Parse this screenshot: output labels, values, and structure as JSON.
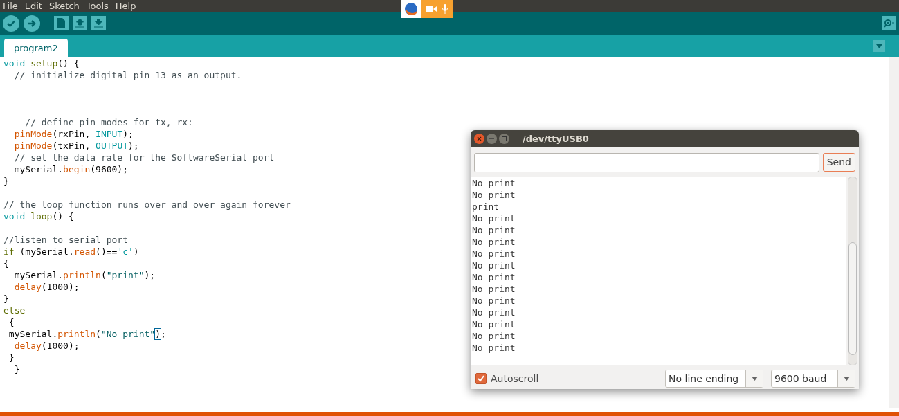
{
  "menu": [
    "File",
    "Edit",
    "Sketch",
    "Tools",
    "Help"
  ],
  "tabs": [
    {
      "label": "program2",
      "selected": true
    }
  ],
  "editor": {
    "lines": [
      {
        "kind": "code",
        "tokens": [
          {
            "text": "void ",
            "kind": "type"
          },
          {
            "text": "setup",
            "kind": "keyword"
          },
          {
            "text": "() {",
            "kind": "plain"
          }
        ]
      },
      {
        "kind": "code",
        "tokens": [
          {
            "text": "  // initialize digital pin 13 as an output.",
            "kind": "comment"
          }
        ]
      },
      {
        "kind": "blank"
      },
      {
        "kind": "blank"
      },
      {
        "kind": "blank"
      },
      {
        "kind": "code",
        "tokens": [
          {
            "text": "    // define pin modes for tx, rx:",
            "kind": "comment"
          }
        ]
      },
      {
        "kind": "code",
        "tokens": [
          {
            "text": "  pinMode",
            "kind": "method"
          },
          {
            "text": "(rxPin, ",
            "kind": "plain"
          },
          {
            "text": "INPUT",
            "kind": "constant"
          },
          {
            "text": ");",
            "kind": "plain"
          }
        ]
      },
      {
        "kind": "code",
        "tokens": [
          {
            "text": "  pinMode",
            "kind": "method"
          },
          {
            "text": "(txPin, ",
            "kind": "plain"
          },
          {
            "text": "OUTPUT",
            "kind": "constant"
          },
          {
            "text": ");",
            "kind": "plain"
          }
        ]
      },
      {
        "kind": "code",
        "tokens": [
          {
            "text": "  // set the data rate for the SoftwareSerial port",
            "kind": "comment"
          }
        ]
      },
      {
        "kind": "code",
        "tokens": [
          {
            "text": "  mySerial.",
            "kind": "plain"
          },
          {
            "text": "begin",
            "kind": "method"
          },
          {
            "text": "(9600);",
            "kind": "plain"
          }
        ]
      },
      {
        "kind": "code",
        "tokens": [
          {
            "text": "}",
            "kind": "plain"
          }
        ]
      },
      {
        "kind": "blank"
      },
      {
        "kind": "code",
        "tokens": [
          {
            "text": "// the loop function runs over and over again forever",
            "kind": "comment"
          }
        ]
      },
      {
        "kind": "code",
        "tokens": [
          {
            "text": "void ",
            "kind": "type"
          },
          {
            "text": "loop",
            "kind": "keyword"
          },
          {
            "text": "() {",
            "kind": "plain"
          }
        ]
      },
      {
        "kind": "blank"
      },
      {
        "kind": "code",
        "tokens": [
          {
            "text": "//listen to serial port",
            "kind": "comment"
          }
        ]
      },
      {
        "kind": "code",
        "tokens": [
          {
            "text": "if",
            "kind": "keyword"
          },
          {
            "text": " (mySerial.",
            "kind": "plain"
          },
          {
            "text": "read",
            "kind": "method"
          },
          {
            "text": "()==",
            "kind": "plain"
          },
          {
            "text": "'c'",
            "kind": "constant"
          },
          {
            "text": ")",
            "kind": "plain"
          }
        ]
      },
      {
        "kind": "code",
        "tokens": [
          {
            "text": "{",
            "kind": "plain"
          }
        ]
      },
      {
        "kind": "code",
        "tokens": [
          {
            "text": "  mySerial.",
            "kind": "plain"
          },
          {
            "text": "println",
            "kind": "method"
          },
          {
            "text": "(",
            "kind": "plain"
          },
          {
            "text": "\"print\"",
            "kind": "string"
          },
          {
            "text": ");",
            "kind": "plain"
          }
        ]
      },
      {
        "kind": "code",
        "tokens": [
          {
            "text": "  delay",
            "kind": "method"
          },
          {
            "text": "(1000);",
            "kind": "plain"
          }
        ]
      },
      {
        "kind": "code",
        "tokens": [
          {
            "text": "}",
            "kind": "plain"
          }
        ]
      },
      {
        "kind": "code",
        "tokens": [
          {
            "text": "else",
            "kind": "keyword"
          }
        ]
      },
      {
        "kind": "code",
        "tokens": [
          {
            "text": " {",
            "kind": "plain"
          }
        ]
      },
      {
        "kind": "code",
        "tokens": [
          {
            "text": " mySerial.",
            "kind": "plain"
          },
          {
            "text": "println",
            "kind": "method"
          },
          {
            "text": "(",
            "kind": "plain"
          },
          {
            "text": "\"No print\"",
            "kind": "string"
          },
          {
            "text": ")",
            "kind": "bracket-match"
          },
          {
            "text": ";",
            "kind": "plain"
          }
        ]
      },
      {
        "kind": "code",
        "tokens": [
          {
            "text": "  delay",
            "kind": "method"
          },
          {
            "text": "(1000);",
            "kind": "plain"
          }
        ]
      },
      {
        "kind": "code",
        "tokens": [
          {
            "text": " }",
            "kind": "plain"
          }
        ]
      },
      {
        "kind": "code",
        "tokens": [
          {
            "text": "  }",
            "kind": "plain"
          }
        ]
      }
    ]
  },
  "serial_monitor": {
    "title": "/dev/ttyUSB0",
    "send_button": "Send",
    "output": [
      "No print",
      "No print",
      "print",
      "No print",
      "No print",
      "No print",
      "No print",
      "No print",
      "No print",
      "No print",
      "No print",
      "No print",
      "No print",
      "No print",
      "No print"
    ],
    "autoscroll": {
      "label": "Autoscroll",
      "checked": true
    },
    "line_ending": "No line ending",
    "baud": "9600 baud"
  }
}
